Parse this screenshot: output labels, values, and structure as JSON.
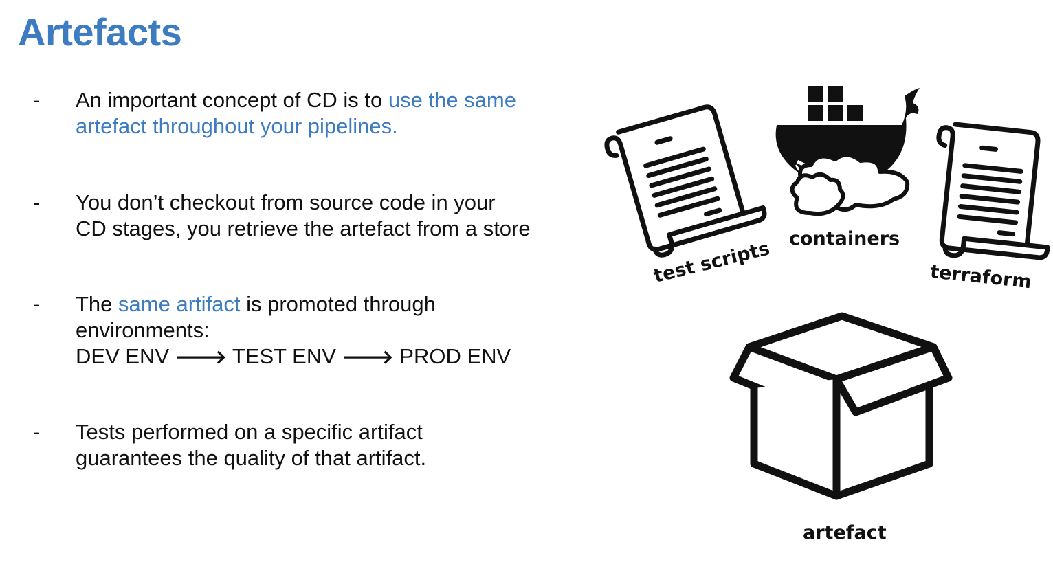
{
  "slide": {
    "title": "Artefacts"
  },
  "bullets": [
    {
      "dash": "-",
      "line1_pre": "An important concept of CD is to ",
      "line1_hl": "use the same",
      "line2_hl": "artefact throughout your pipelines."
    },
    {
      "dash": "-",
      "line1": "You don’t checkout from source code in your",
      "line2": "CD stages, you retrieve the artefact from a store"
    },
    {
      "dash": "-",
      "line1_pre": "The ",
      "line1_hl": "same artifact",
      "line1_post": " is promoted through",
      "line2": "environments:",
      "env1": "DEV ENV",
      "env2": "TEST ENV",
      "env3": "PROD ENV",
      "arrow": "🡒"
    },
    {
      "dash": "-",
      "line1": "Tests performed on a specific artifact",
      "line2": "guarantees the quality of that artifact."
    }
  ],
  "illustration": {
    "test_scripts_label": "test scripts",
    "containers_label": "containers",
    "terraform_label": "terraform",
    "artefact_label": "artefact"
  },
  "colors": {
    "accent": "#3d7cc0",
    "text": "#111111",
    "background": "#ffffff"
  }
}
